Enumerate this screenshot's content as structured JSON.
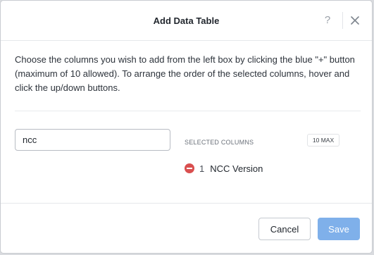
{
  "dialog": {
    "title": "Add Data Table",
    "help_label": "?",
    "instructions": "Choose the columns you wish to add from the left box by clicking the blue \"+\" button (maximum of 10 allowed). To arrange the order of the selected columns, hover and click the up/down buttons."
  },
  "search": {
    "value": "ncc",
    "placeholder": ""
  },
  "selected": {
    "label": "SELECTED COLUMNS",
    "max_badge": "10 MAX",
    "items": [
      {
        "index": "1",
        "name": "NCC Version"
      }
    ]
  },
  "footer": {
    "cancel_label": "Cancel",
    "save_label": "Save"
  },
  "colors": {
    "accent": "#7fb0ea",
    "remove": "#d94f4f"
  },
  "icons": {
    "help": "help-icon",
    "close": "close-icon",
    "remove": "remove-icon"
  }
}
